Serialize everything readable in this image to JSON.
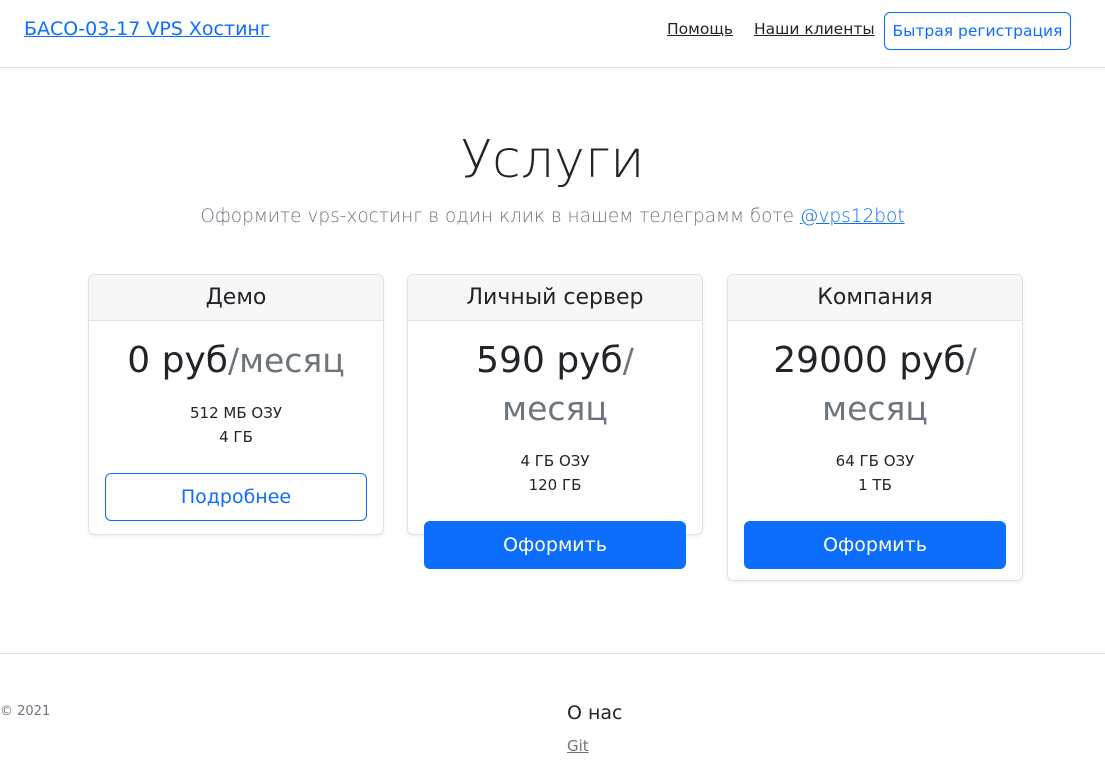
{
  "navbar": {
    "brand": "БАСО-03-17 VPS Хостинг",
    "links": [
      {
        "label": "Помощь"
      },
      {
        "label": "Наши клиенты"
      }
    ],
    "register_label": "Бытрая регистрация"
  },
  "hero": {
    "title": "Услуги",
    "subtitle": "Оформите vps-хостинг в один клик в нашем телеграмм боте ",
    "bot_link": "@vps12bot"
  },
  "plans": [
    {
      "name": "Демо",
      "price": "0 руб",
      "period": "/месяц",
      "ram": "512 МБ ОЗУ",
      "disk": "4 ГБ",
      "button": "Подробнее"
    },
    {
      "name": "Личный сервер",
      "price": "590 руб",
      "period": "/месяц",
      "ram": "4 ГБ ОЗУ",
      "disk": "120 ГБ",
      "button": "Оформить"
    },
    {
      "name": "Компания",
      "price": "29000 руб",
      "period": "/месяц",
      "ram": "64 ГБ ОЗУ",
      "disk": "1 ТБ",
      "button": "Оформить"
    }
  ],
  "footer": {
    "copyright": "© 2021",
    "about_title": "О нас",
    "git_link": "Git"
  },
  "colors": {
    "primary": "#0d6efd",
    "muted": "#6c757d",
    "text": "#212529"
  }
}
